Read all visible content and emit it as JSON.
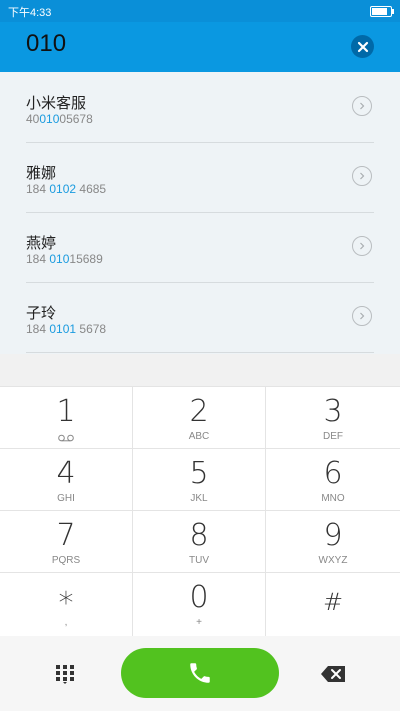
{
  "status_bar": {
    "time": "下午4:33"
  },
  "search": {
    "query": "010"
  },
  "contacts": [
    {
      "name": "小米客服",
      "number_prefix": "40",
      "number_match": "010",
      "number_suffix": "05678"
    },
    {
      "name": "雅娜",
      "number_prefix": "184 ",
      "number_match": "0102",
      "number_suffix": " 4685"
    },
    {
      "name": "燕婷",
      "number_prefix": "184 ",
      "number_match": "010",
      "number_suffix": "15689"
    },
    {
      "name": "子玲",
      "number_prefix": "184 ",
      "number_match": "0101",
      "number_suffix": " 5678"
    }
  ],
  "keypad": [
    {
      "digit": "1",
      "letters": ""
    },
    {
      "digit": "2",
      "letters": "ABC"
    },
    {
      "digit": "3",
      "letters": "DEF"
    },
    {
      "digit": "4",
      "letters": "GHI"
    },
    {
      "digit": "5",
      "letters": "JKL"
    },
    {
      "digit": "6",
      "letters": "MNO"
    },
    {
      "digit": "7",
      "letters": "PQRS"
    },
    {
      "digit": "8",
      "letters": "TUV"
    },
    {
      "digit": "9",
      "letters": "WXYZ"
    },
    {
      "digit": "∗",
      "letters": ","
    },
    {
      "digit": "0",
      "letters": "+"
    },
    {
      "digit": "#",
      "letters": ""
    }
  ],
  "icons": {
    "clear": "close-icon",
    "voicemail": "voicemail-icon",
    "dialpad": "dialpad-icon",
    "call": "phone-icon",
    "backspace": "backspace-icon"
  },
  "colors": {
    "header": "#0a98e1",
    "match_highlight": "#1a9bdf",
    "call_button": "#52c21f"
  }
}
